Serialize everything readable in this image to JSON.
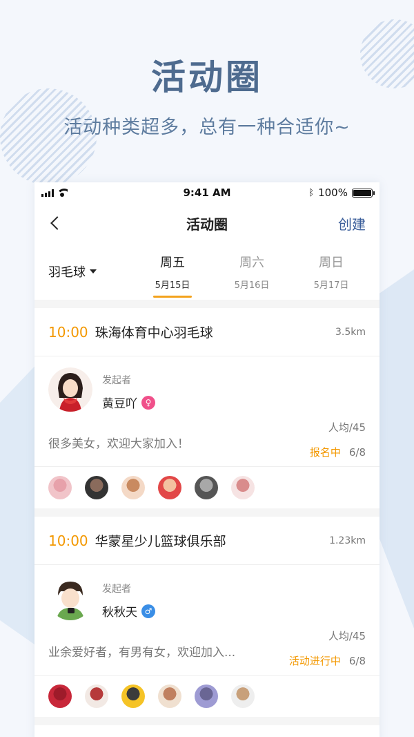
{
  "hero": {
    "title": "活动圈",
    "subtitle": "活动种类超多，总有一种合适你~"
  },
  "status_bar": {
    "time": "9:41 AM",
    "battery": "100%",
    "battery_level": 1.0,
    "icons": [
      "signal-icon",
      "wifi-icon",
      "bluetooth-icon",
      "battery-icon"
    ]
  },
  "navbar": {
    "back_icon": "chevron-left-icon",
    "title": "活动圈",
    "create_label": "创建"
  },
  "filter": {
    "sport": "羽毛球",
    "days": [
      {
        "name": "周五",
        "date": "5月15日",
        "active": true
      },
      {
        "name": "周六",
        "date": "5月16日",
        "active": false
      },
      {
        "name": "周日",
        "date": "5月17日",
        "active": false
      }
    ]
  },
  "colors": {
    "accent": "#f39800",
    "brand_blue": "#3c5f9b",
    "hero_title": "#4e6b8f",
    "female_badge": "#f0508a",
    "male_badge": "#3a8ee6"
  },
  "activities": [
    {
      "time": "10:00",
      "name": "珠海体育中心羽毛球",
      "distance": "3.5km",
      "host_label": "发起者",
      "host_name": "黄豆吖",
      "host_gender": "female",
      "desc": "很多美女，欢迎大家加入！",
      "avg_price": "人均/45",
      "status": "报名中",
      "count": "6/8",
      "members": 6
    },
    {
      "time": "10:00",
      "name": "华蒙星少儿篮球俱乐部",
      "distance": "1.23km",
      "host_label": "发起者",
      "host_name": "秋秋天",
      "host_gender": "male",
      "desc": "业余爱好者，有男有女，欢迎加入...",
      "avg_price": "人均/45",
      "status": "活动进行中",
      "count": "6/8",
      "members": 6
    }
  ]
}
